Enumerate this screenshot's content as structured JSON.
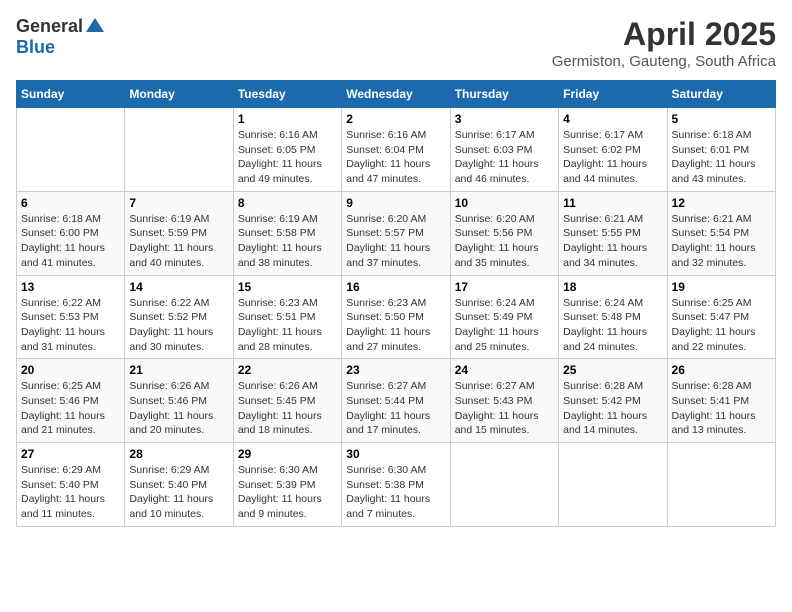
{
  "logo": {
    "general": "General",
    "blue": "Blue"
  },
  "title": "April 2025",
  "subtitle": "Germiston, Gauteng, South Africa",
  "days_header": [
    "Sunday",
    "Monday",
    "Tuesday",
    "Wednesday",
    "Thursday",
    "Friday",
    "Saturday"
  ],
  "weeks": [
    [
      {
        "num": "",
        "info": ""
      },
      {
        "num": "",
        "info": ""
      },
      {
        "num": "1",
        "info": "Sunrise: 6:16 AM\nSunset: 6:05 PM\nDaylight: 11 hours and 49 minutes."
      },
      {
        "num": "2",
        "info": "Sunrise: 6:16 AM\nSunset: 6:04 PM\nDaylight: 11 hours and 47 minutes."
      },
      {
        "num": "3",
        "info": "Sunrise: 6:17 AM\nSunset: 6:03 PM\nDaylight: 11 hours and 46 minutes."
      },
      {
        "num": "4",
        "info": "Sunrise: 6:17 AM\nSunset: 6:02 PM\nDaylight: 11 hours and 44 minutes."
      },
      {
        "num": "5",
        "info": "Sunrise: 6:18 AM\nSunset: 6:01 PM\nDaylight: 11 hours and 43 minutes."
      }
    ],
    [
      {
        "num": "6",
        "info": "Sunrise: 6:18 AM\nSunset: 6:00 PM\nDaylight: 11 hours and 41 minutes."
      },
      {
        "num": "7",
        "info": "Sunrise: 6:19 AM\nSunset: 5:59 PM\nDaylight: 11 hours and 40 minutes."
      },
      {
        "num": "8",
        "info": "Sunrise: 6:19 AM\nSunset: 5:58 PM\nDaylight: 11 hours and 38 minutes."
      },
      {
        "num": "9",
        "info": "Sunrise: 6:20 AM\nSunset: 5:57 PM\nDaylight: 11 hours and 37 minutes."
      },
      {
        "num": "10",
        "info": "Sunrise: 6:20 AM\nSunset: 5:56 PM\nDaylight: 11 hours and 35 minutes."
      },
      {
        "num": "11",
        "info": "Sunrise: 6:21 AM\nSunset: 5:55 PM\nDaylight: 11 hours and 34 minutes."
      },
      {
        "num": "12",
        "info": "Sunrise: 6:21 AM\nSunset: 5:54 PM\nDaylight: 11 hours and 32 minutes."
      }
    ],
    [
      {
        "num": "13",
        "info": "Sunrise: 6:22 AM\nSunset: 5:53 PM\nDaylight: 11 hours and 31 minutes."
      },
      {
        "num": "14",
        "info": "Sunrise: 6:22 AM\nSunset: 5:52 PM\nDaylight: 11 hours and 30 minutes."
      },
      {
        "num": "15",
        "info": "Sunrise: 6:23 AM\nSunset: 5:51 PM\nDaylight: 11 hours and 28 minutes."
      },
      {
        "num": "16",
        "info": "Sunrise: 6:23 AM\nSunset: 5:50 PM\nDaylight: 11 hours and 27 minutes."
      },
      {
        "num": "17",
        "info": "Sunrise: 6:24 AM\nSunset: 5:49 PM\nDaylight: 11 hours and 25 minutes."
      },
      {
        "num": "18",
        "info": "Sunrise: 6:24 AM\nSunset: 5:48 PM\nDaylight: 11 hours and 24 minutes."
      },
      {
        "num": "19",
        "info": "Sunrise: 6:25 AM\nSunset: 5:47 PM\nDaylight: 11 hours and 22 minutes."
      }
    ],
    [
      {
        "num": "20",
        "info": "Sunrise: 6:25 AM\nSunset: 5:46 PM\nDaylight: 11 hours and 21 minutes."
      },
      {
        "num": "21",
        "info": "Sunrise: 6:26 AM\nSunset: 5:46 PM\nDaylight: 11 hours and 20 minutes."
      },
      {
        "num": "22",
        "info": "Sunrise: 6:26 AM\nSunset: 5:45 PM\nDaylight: 11 hours and 18 minutes."
      },
      {
        "num": "23",
        "info": "Sunrise: 6:27 AM\nSunset: 5:44 PM\nDaylight: 11 hours and 17 minutes."
      },
      {
        "num": "24",
        "info": "Sunrise: 6:27 AM\nSunset: 5:43 PM\nDaylight: 11 hours and 15 minutes."
      },
      {
        "num": "25",
        "info": "Sunrise: 6:28 AM\nSunset: 5:42 PM\nDaylight: 11 hours and 14 minutes."
      },
      {
        "num": "26",
        "info": "Sunrise: 6:28 AM\nSunset: 5:41 PM\nDaylight: 11 hours and 13 minutes."
      }
    ],
    [
      {
        "num": "27",
        "info": "Sunrise: 6:29 AM\nSunset: 5:40 PM\nDaylight: 11 hours and 11 minutes."
      },
      {
        "num": "28",
        "info": "Sunrise: 6:29 AM\nSunset: 5:40 PM\nDaylight: 11 hours and 10 minutes."
      },
      {
        "num": "29",
        "info": "Sunrise: 6:30 AM\nSunset: 5:39 PM\nDaylight: 11 hours and 9 minutes."
      },
      {
        "num": "30",
        "info": "Sunrise: 6:30 AM\nSunset: 5:38 PM\nDaylight: 11 hours and 7 minutes."
      },
      {
        "num": "",
        "info": ""
      },
      {
        "num": "",
        "info": ""
      },
      {
        "num": "",
        "info": ""
      }
    ]
  ]
}
